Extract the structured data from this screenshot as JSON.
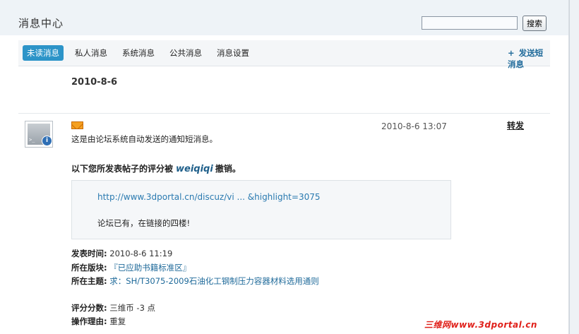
{
  "header": {
    "title": "消息中心",
    "search_placeholder": "",
    "search_button": "搜索"
  },
  "tabs": [
    {
      "label": "未读消息",
      "active": true
    },
    {
      "label": "私人消息",
      "active": false
    },
    {
      "label": "系统消息",
      "active": false
    },
    {
      "label": "公共消息",
      "active": false
    },
    {
      "label": "消息设置",
      "active": false
    }
  ],
  "send_link": {
    "plus": "+",
    "label": "发送短消息"
  },
  "date_group": "2010-8-6",
  "message": {
    "avatar_icon": "system-avatar-icon",
    "mail_icon": "envelope-icon",
    "time": "2010-8-6 13:07",
    "forward_label": "转发",
    "notice": "这是由论坛系统自动发送的通知短消息。",
    "rating_prefix": "以下您所发表帖子的评分被",
    "rating_user": "weiqiqi",
    "rating_suffix": "撤销。",
    "quote_url": "http://www.3dportal.cn/discuz/vi ... &highlight=3075",
    "quote_text": "论坛已有，在链接的四楼!",
    "post_time_label": "发表时间:",
    "post_time": "2010-8-6 11:19",
    "forum_label": "所在版块:",
    "forum": "『已应助书籍标准区』",
    "thread_label": "所在主题:",
    "thread": "求：SH/T3075-2009石油化工钢制压力容器材料选用通则",
    "score_label": "评分分数:",
    "score": "三维币  -3 点",
    "reason_label": "操作理由:",
    "reason": "重复"
  },
  "watermark": "三维网www.3dportal.cn",
  "colors": {
    "accent": "#2c94c8",
    "link": "#1f6a9a",
    "watermark": "#e0201a"
  }
}
